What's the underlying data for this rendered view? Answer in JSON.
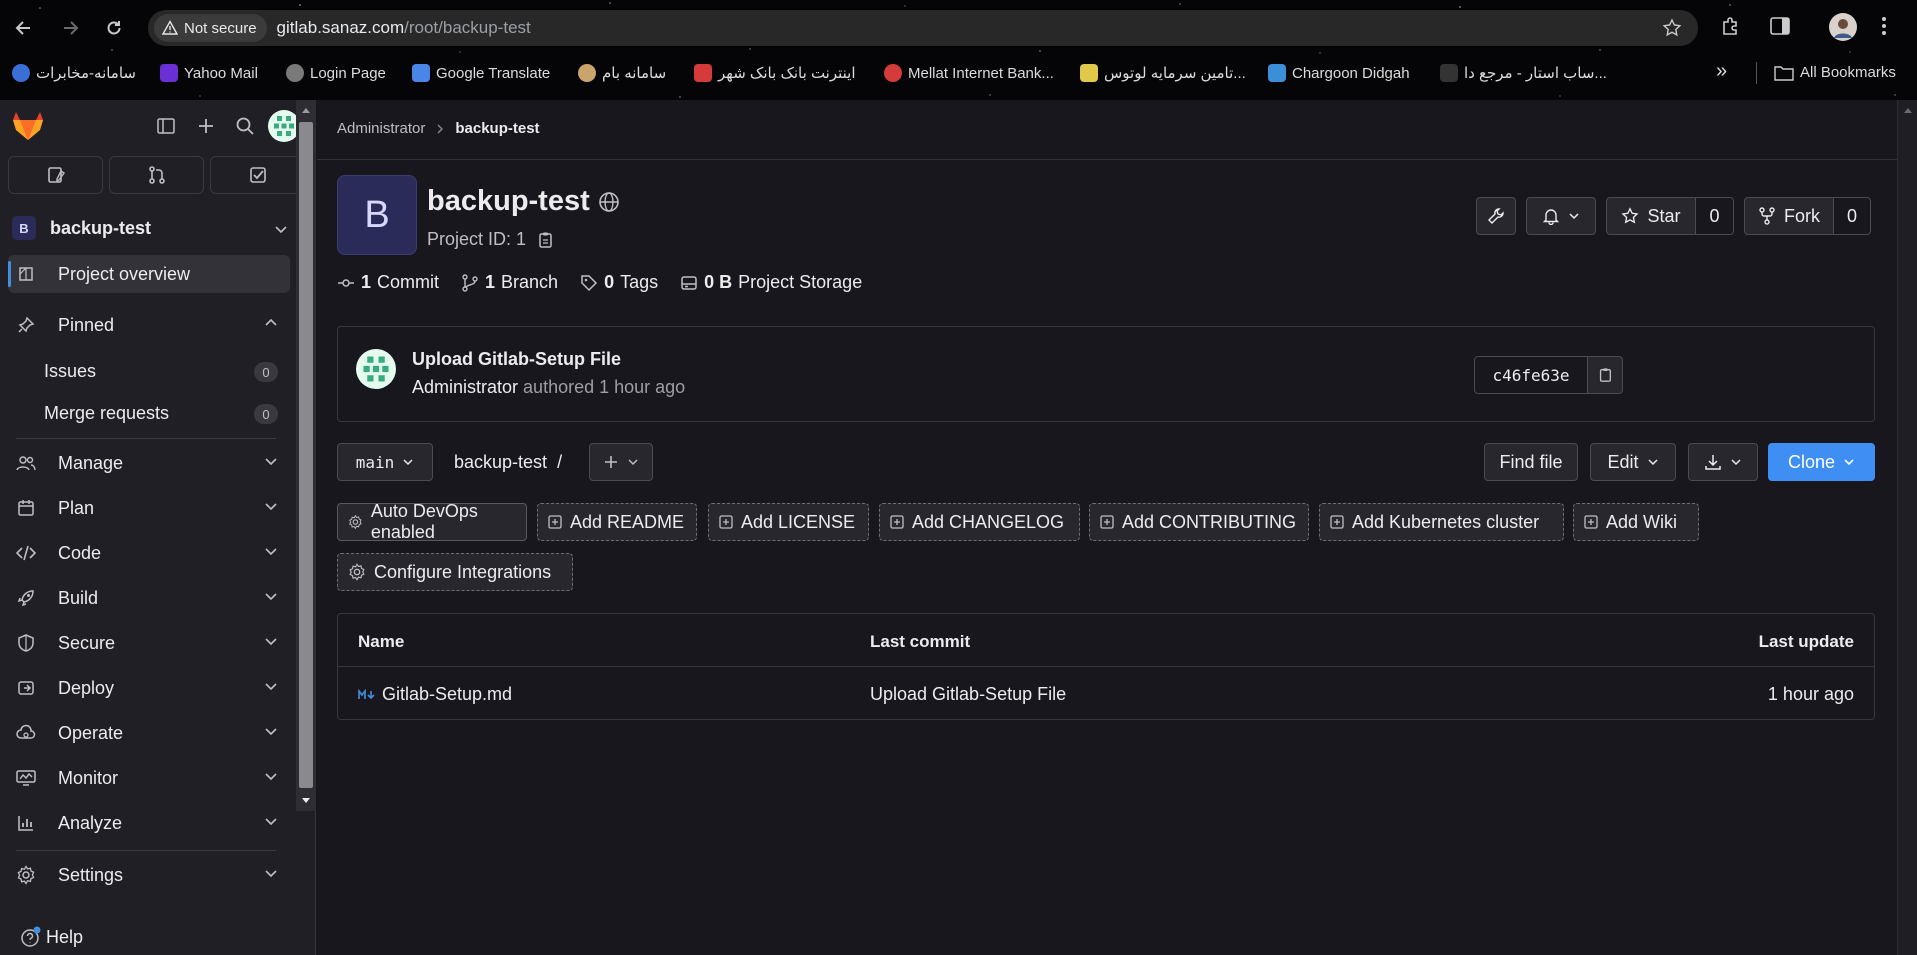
{
  "browser": {
    "security_label": "Not secure",
    "url_host": "gitlab.sanaz.com",
    "url_path": "/root/backup-test",
    "bookmarks": [
      {
        "label": "سامانه-مخابرات",
        "color": "#3b6fd8"
      },
      {
        "label": "Yahoo Mail",
        "color": "#6b2fd6"
      },
      {
        "label": "Login Page",
        "color": "#7a7a7a"
      },
      {
        "label": "Google Translate",
        "color": "#4a86e8"
      },
      {
        "label": "سامانه بام",
        "color": "#c9a46b"
      },
      {
        "label": "اینترنت بانک بانک شهر",
        "color": "#d63b3b"
      },
      {
        "label": "Mellat Internet Bank...",
        "color": "#d63b3b"
      },
      {
        "label": "تامین سرمایه لوتوس...",
        "color": "#e0c84a"
      },
      {
        "label": "Chargoon Didgah",
        "color": "#3b8ed8"
      },
      {
        "label": "ساب استار - مرجع دا...",
        "color": "#222222"
      }
    ],
    "more_label": "»",
    "all_bookmarks": "All Bookmarks"
  },
  "sidebar": {
    "project_initial": "B",
    "project_name": "backup-test",
    "overview": "Project overview",
    "pinned": "Pinned",
    "pinned_items": [
      {
        "label": "Issues",
        "count": "0"
      },
      {
        "label": "Merge requests",
        "count": "0"
      }
    ],
    "sections": [
      "Manage",
      "Plan",
      "Code",
      "Build",
      "Secure",
      "Deploy",
      "Operate",
      "Monitor",
      "Analyze"
    ],
    "settings": "Settings",
    "help": "Help"
  },
  "breadcrumb": {
    "parent": "Administrator",
    "current": "backup-test"
  },
  "project": {
    "initial": "B",
    "title": "backup-test",
    "id_label": "Project ID: 1",
    "star_label": "Star",
    "star_count": "0",
    "fork_label": "Fork",
    "fork_count": "0"
  },
  "stats": {
    "commits_num": "1",
    "commits_label": "Commit",
    "branches_num": "1",
    "branches_label": "Branch",
    "tags_num": "0",
    "tags_label": "Tags",
    "storage_num": "0 B",
    "storage_label": "Project Storage"
  },
  "last_commit": {
    "title": "Upload Gitlab-Setup File",
    "author": "Administrator",
    "meta": "authored 1 hour ago",
    "sha": "c46fe63e"
  },
  "repo": {
    "branch": "main",
    "path": "backup-test",
    "slash": "/",
    "find_file": "Find file",
    "edit": "Edit",
    "clone": "Clone"
  },
  "suggestions": [
    "Auto DevOps enabled",
    "Add README",
    "Add LICENSE",
    "Add CHANGELOG",
    "Add CONTRIBUTING",
    "Add Kubernetes cluster",
    "Add Wiki",
    "Configure Integrations"
  ],
  "files": {
    "headers": {
      "name": "Name",
      "last_commit": "Last commit",
      "last_update": "Last update"
    },
    "rows": [
      {
        "name": "Gitlab-Setup.md",
        "commit": "Upload Gitlab-Setup File",
        "updated": "1 hour ago"
      }
    ]
  },
  "colors": {
    "accent": "#428fdc",
    "clone_button": "#3e8ef4",
    "gitlab_orange": "#fc6d26",
    "background": "#18171d",
    "sidebar": "#201f25"
  }
}
